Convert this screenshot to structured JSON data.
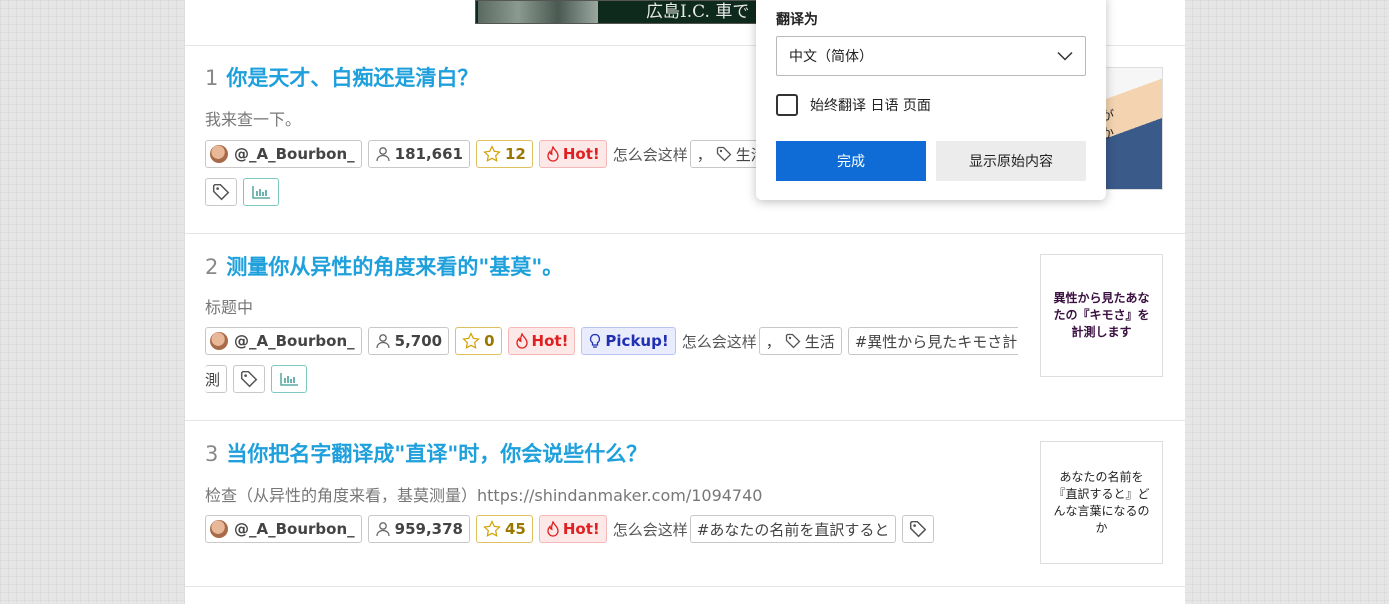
{
  "banner": {
    "text": "広島I.C. 車で"
  },
  "items": [
    {
      "rank": "1",
      "title": "你是天才、白痴还是清白？",
      "desc": "我来查一下。",
      "author": "@_A_Bourbon_",
      "views": "181,661",
      "stars": "12",
      "hot": "Hot!",
      "question": "怎么会这样",
      "tag_life": "，",
      "tag_life_label": "生活",
      "thumb_text": "天才が\n清楚か"
    },
    {
      "rank": "2",
      "title": "测量你从异性的角度来看的\"基莫\"。",
      "desc": "标题中",
      "author": "@_A_Bourbon_",
      "views": "5,700",
      "stars": "0",
      "hot": "Hot!",
      "pickup": "Pickup!",
      "question": "怎么会这样",
      "tag_life": "，",
      "tag_life_label": "生活",
      "tag_hash": "#異性から見たキモさ計",
      "tag_hash_cont": "測",
      "thumb_text": "異性から見たあなたの『キモさ』を計測します"
    },
    {
      "rank": "3",
      "title": "当你把名字翻译成\"直译\"时，你会说些什么？",
      "desc": "检查（从异性的角度来看，基莫测量）https://shindanmaker.com/1094740",
      "author": "@_A_Bourbon_",
      "views": "959,378",
      "stars": "45",
      "hot": "Hot!",
      "question": "怎么会这样",
      "tag_hash": "#あなたの名前を直訳すると",
      "thumb_text": "あなたの名前を『直訳すると』どんな言葉になるのか"
    }
  ],
  "translate_popup": {
    "label": "翻译为",
    "selected_language": "中文（简体）",
    "always_translate": "始终翻译 日语 页面",
    "always_checked": false,
    "done_button": "完成",
    "show_original_button": "显示原始内容"
  },
  "colors": {
    "title": "#1ea0dc",
    "done_button": "#0f6cd6",
    "hot": "#e02020"
  }
}
